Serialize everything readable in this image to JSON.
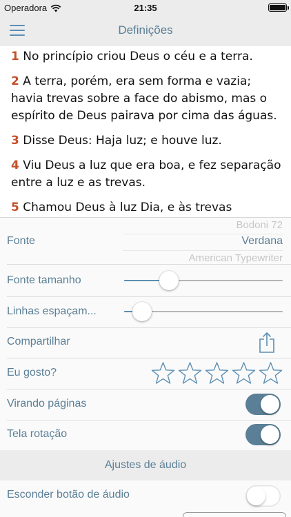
{
  "status_bar": {
    "carrier": "Operadora",
    "time": "21:35"
  },
  "nav": {
    "title": "Definições"
  },
  "verses": [
    {
      "num": "1",
      "text": "No princípio criou Deus o céu e a terra."
    },
    {
      "num": "2",
      "text": "A terra, porém, era sem forma e vazia; havia trevas sobre a face do abismo, mas o espírito de Deus pairava por cima das águas."
    },
    {
      "num": "3",
      "text": "Disse Deus: Haja luz; e houve luz."
    },
    {
      "num": "4",
      "text": "Viu Deus a luz que era boa, e fez separação entre a luz e as trevas."
    },
    {
      "num": "5",
      "text": "Chamou Deus à luz Dia, e às trevas"
    }
  ],
  "settings": {
    "font": {
      "label": "Fonte",
      "options": [
        "Bodoni 72",
        "Verdana",
        "American Typewriter"
      ],
      "selected": "Verdana"
    },
    "font_size": {
      "label": "Fonte tamanho",
      "value_fraction": 0.25
    },
    "line_spacing": {
      "label": "Linhas espaçam...",
      "value_fraction": 0.06
    },
    "share": {
      "label": "Compartilhar"
    },
    "rating": {
      "label": "Eu gosto?",
      "stars_total": 5,
      "stars_filled": 0
    },
    "page_turn": {
      "label": "Virando páginas",
      "on": true
    },
    "rotation": {
      "label": "Tela rotação",
      "on": true
    },
    "audio_section": "Ajustes de áudio",
    "hide_audio": {
      "label": "Esconder botão de áudio",
      "on": false
    }
  },
  "colors": {
    "accent": "#5a7f96",
    "verse_number": "#c4502a",
    "bar_background": "#ececec"
  },
  "icons": {
    "menu": "hamburger-icon",
    "share": "share-icon",
    "star": "star-outline-icon",
    "wifi": "wifi-icon",
    "battery": "battery-icon"
  }
}
